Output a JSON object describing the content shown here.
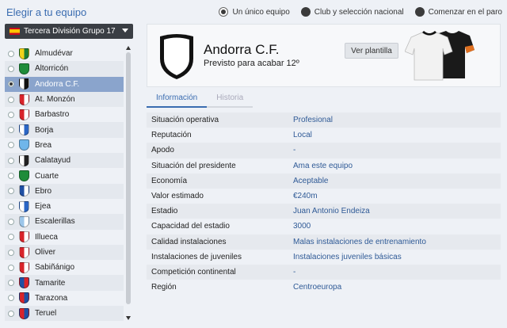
{
  "header": {
    "title": "Elegir a tu equipo",
    "mode_options": [
      {
        "label": "Un único equipo",
        "selected": true
      },
      {
        "label": "Club y selección nacional",
        "selected": false
      },
      {
        "label": "Comenzar en el paro",
        "selected": false
      }
    ]
  },
  "division": {
    "label": "Tercera División Grupo 17",
    "flag": "spain-flag"
  },
  "teams": [
    {
      "name": "Almudévar",
      "colors": [
        "#f2d21a",
        "#1e7e34"
      ]
    },
    {
      "name": "Altorricón",
      "colors": [
        "#1e8c3a",
        "#1e8c3a"
      ]
    },
    {
      "name": "Andorra C.F.",
      "colors": [
        "#ffffff",
        "#111111"
      ],
      "selected": true
    },
    {
      "name": "At. Monzón",
      "colors": [
        "#d8232a",
        "#ffffff"
      ]
    },
    {
      "name": "Barbastro",
      "colors": [
        "#d8232a",
        "#ffffff"
      ]
    },
    {
      "name": "Borja",
      "colors": [
        "#ffffff",
        "#2b66c5"
      ]
    },
    {
      "name": "Brea",
      "colors": [
        "#6fb6ea",
        "#6fb6ea"
      ]
    },
    {
      "name": "Calatayud",
      "colors": [
        "#ffffff",
        "#222222"
      ]
    },
    {
      "name": "Cuarte",
      "colors": [
        "#1e8c3a",
        "#1e8c3a"
      ]
    },
    {
      "name": "Ebro",
      "colors": [
        "#1f4fa3",
        "#ffffff"
      ]
    },
    {
      "name": "Ejea",
      "colors": [
        "#ffffff",
        "#2b66c5"
      ]
    },
    {
      "name": "Escalerillas",
      "colors": [
        "#9cc6ea",
        "#ffffff"
      ]
    },
    {
      "name": "Illueca",
      "colors": [
        "#d8232a",
        "#ffffff"
      ]
    },
    {
      "name": "Oliver",
      "colors": [
        "#d8232a",
        "#ffffff"
      ]
    },
    {
      "name": "Sabiñánigo",
      "colors": [
        "#d8232a",
        "#ffffff"
      ]
    },
    {
      "name": "Tamarite",
      "colors": [
        "#1f4fa3",
        "#d8232a"
      ]
    },
    {
      "name": "Tarazona",
      "colors": [
        "#d8232a",
        "#1f4fa3"
      ]
    },
    {
      "name": "Teruel",
      "colors": [
        "#d8232a",
        "#1f4fa3"
      ]
    }
  ],
  "club": {
    "name": "Andorra C.F.",
    "subtitle": "Previsto para acabar 12º",
    "squad_button": "Ver plantilla"
  },
  "tabs": [
    {
      "label": "Información",
      "active": true
    },
    {
      "label": "Historia",
      "active": false
    }
  ],
  "info": [
    {
      "label": "Situación operativa",
      "value": "Profesional"
    },
    {
      "label": "Reputación",
      "value": "Local"
    },
    {
      "label": "Apodo",
      "value": "-"
    },
    {
      "label": "Situación del presidente",
      "value": "Ama este equipo"
    },
    {
      "label": "Economía",
      "value": "Aceptable"
    },
    {
      "label": "Valor estimado",
      "value": "€240m"
    },
    {
      "label": "Estadio",
      "value": "Juan Antonio Endeiza"
    },
    {
      "label": "Capacidad del estadio",
      "value": "3000"
    },
    {
      "label": "Calidad instalaciones",
      "value": "Malas instalaciones de entrenamiento"
    },
    {
      "label": "Instalaciones de juveniles",
      "value": "Instalaciones juveniles básicas"
    },
    {
      "label": "Competición continental",
      "value": "-"
    },
    {
      "label": "Región",
      "value": "Centroeuropa"
    }
  ]
}
